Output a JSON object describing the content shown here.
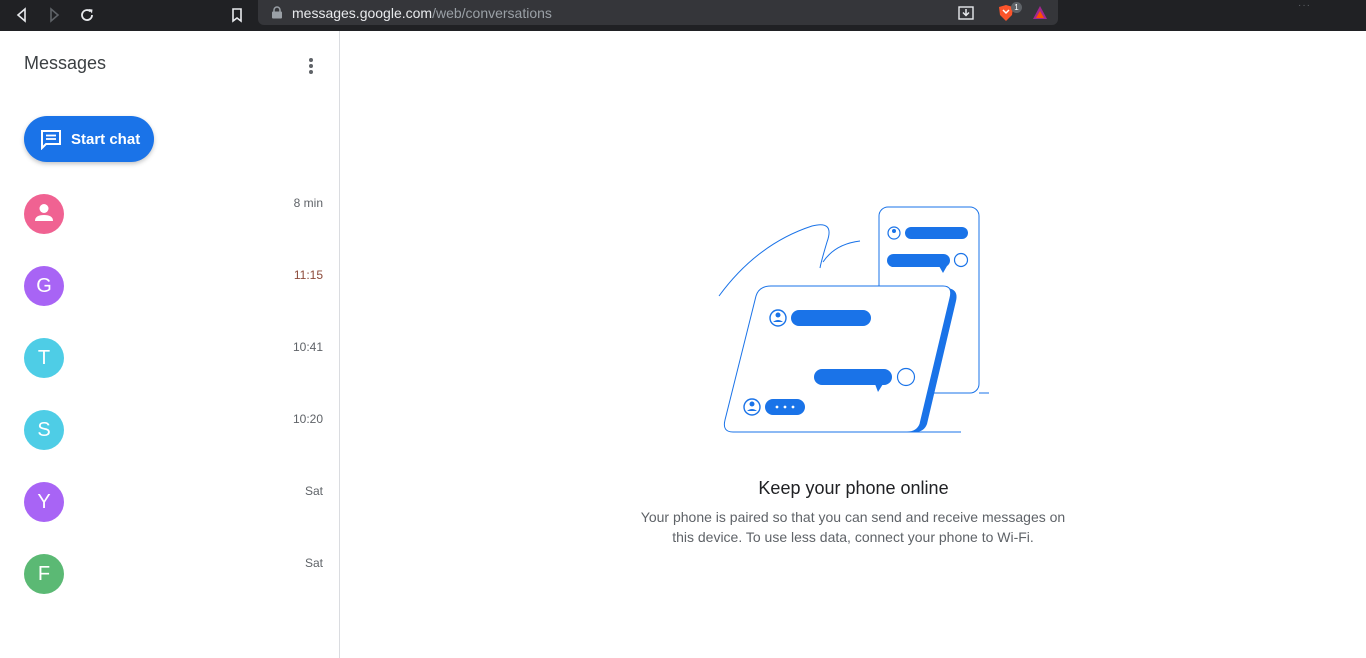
{
  "browser": {
    "url_host": "messages.google.com",
    "url_path": "/web/conversations",
    "brave_badge": "1"
  },
  "sidebar": {
    "title": "Messages",
    "start_chat_label": "Start chat",
    "conversations": [
      {
        "avatar_letter": "",
        "avatar_color": "#f06292",
        "time": "8 min"
      },
      {
        "avatar_letter": "G",
        "avatar_color": "#a864f5",
        "time": "11:15"
      },
      {
        "avatar_letter": "T",
        "avatar_color": "#4ecde6",
        "time": "10:41"
      },
      {
        "avatar_letter": "S",
        "avatar_color": "#4ecde6",
        "time": "10:20"
      },
      {
        "avatar_letter": "Y",
        "avatar_color": "#a864f5",
        "time": "Sat"
      },
      {
        "avatar_letter": "F",
        "avatar_color": "#5bb974",
        "time": "Sat"
      }
    ]
  },
  "main": {
    "empty_title": "Keep your phone online",
    "empty_body": "Your phone is paired so that you can send and receive messages on this device. To use less data, connect your phone to Wi-Fi."
  },
  "colors": {
    "accent": "#1a73e8",
    "chrome_bg": "#202124"
  }
}
